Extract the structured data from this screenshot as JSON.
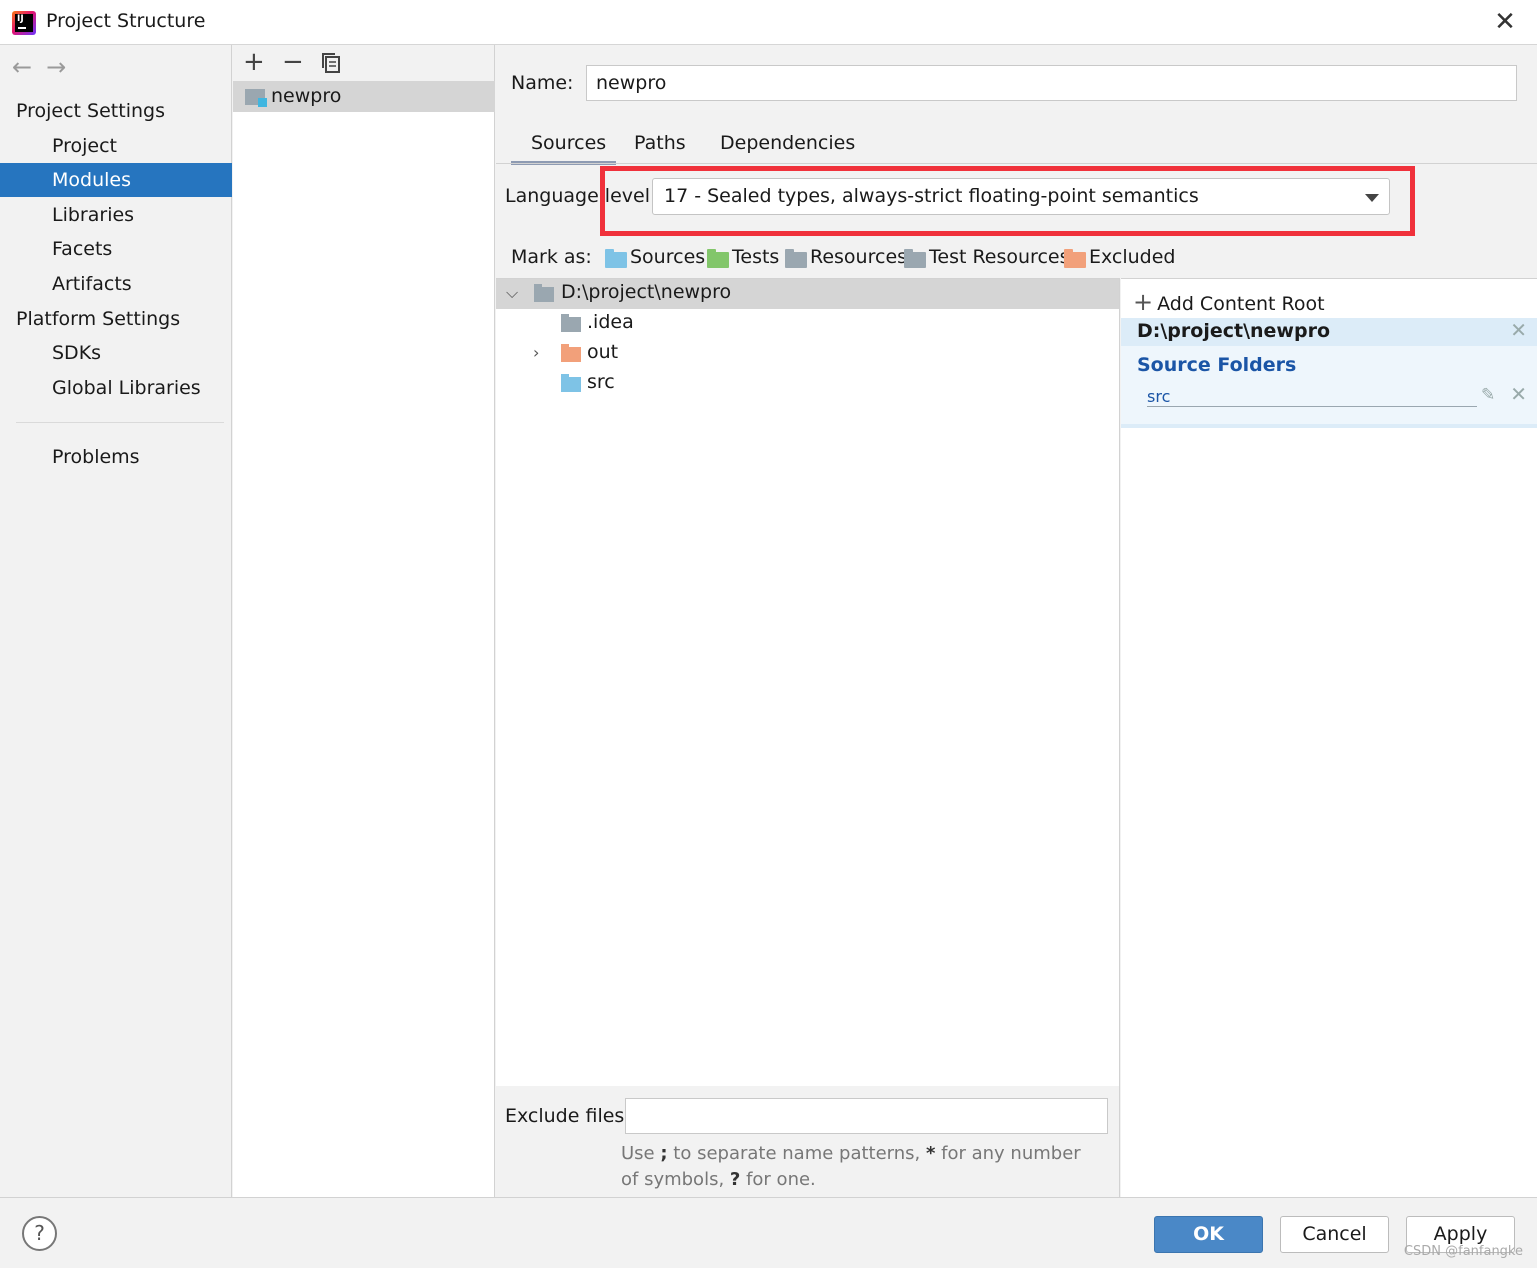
{
  "window": {
    "title": "Project Structure"
  },
  "nav": {
    "back_icon": "arrow-left-icon",
    "forward_icon": "arrow-right-icon",
    "project_settings_header": "Project Settings",
    "project_settings_items": [
      "Project",
      "Modules",
      "Libraries",
      "Facets",
      "Artifacts"
    ],
    "selected_item": "Modules",
    "platform_settings_header": "Platform Settings",
    "platform_settings_items": [
      "SDKs",
      "Global Libraries"
    ],
    "problems": "Problems"
  },
  "modules": {
    "toolbar": {
      "add": "+",
      "remove": "−",
      "copy_icon": "copy-icon"
    },
    "items": [
      "newpro"
    ]
  },
  "module": {
    "name_label": "Name:",
    "name_value": "newpro",
    "tabs": [
      "Sources",
      "Paths",
      "Dependencies"
    ],
    "active_tab": "Sources",
    "language_level_label": "Language level:",
    "language_level_value": "17 - Sealed types, always-strict floating-point semantics",
    "mark_as_label": "Mark as:",
    "mark_as": [
      {
        "label": "Sources",
        "color": "#7ec3e6"
      },
      {
        "label": "Tests",
        "color": "#82c66a"
      },
      {
        "label": "Resources",
        "color": "#9aa7b0"
      },
      {
        "label": "Test Resources",
        "color": "#9aa7b0"
      },
      {
        "label": "Excluded",
        "color": "#f2a07a"
      }
    ],
    "tree": {
      "root": "D:\\project\\newpro",
      "children": [
        {
          "label": ".idea",
          "color": "#9aa7b0",
          "expandable": false
        },
        {
          "label": "out",
          "color": "#f2a07a",
          "expandable": true
        },
        {
          "label": "src",
          "color": "#7ec3e6",
          "expandable": false
        }
      ]
    },
    "exclude_files_label": "Exclude files:",
    "exclude_files_value": "",
    "exclude_hint_1": "Use ",
    "exclude_hint_semicolon": ";",
    "exclude_hint_2": " to separate name patterns, ",
    "exclude_hint_star": "*",
    "exclude_hint_3": " for any number of symbols, ",
    "exclude_hint_q": "?",
    "exclude_hint_4": " for one."
  },
  "content_root": {
    "add_label": "Add Content Root",
    "path": "D:\\project\\newpro",
    "source_folders_title": "Source Folders",
    "source_folders": [
      "src"
    ]
  },
  "buttons": {
    "help": "?",
    "ok": "OK",
    "cancel": "Cancel",
    "apply": "Apply"
  },
  "watermark": "CSDN @fanfangke",
  "colors": {
    "selection": "#2675bf",
    "ok_button": "#4a88c7",
    "highlight": "#f0313b",
    "source_folder_text": "#1b55a6"
  }
}
